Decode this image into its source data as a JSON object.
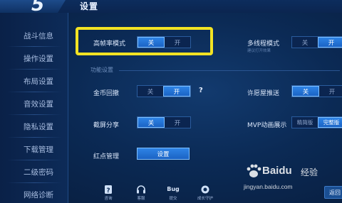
{
  "header": {
    "logo_glyph": "5",
    "title": "设置"
  },
  "sidebar": {
    "items": [
      {
        "label": "战斗信息"
      },
      {
        "label": "操作设置"
      },
      {
        "label": "布局设置"
      },
      {
        "label": "音效设置"
      },
      {
        "label": "隐私设置"
      },
      {
        "label": "下载管理"
      },
      {
        "label": "二级密码"
      },
      {
        "label": "网络诊断"
      }
    ]
  },
  "settings": {
    "high_fps": {
      "label": "高帧率模式",
      "off": "关",
      "on": "开",
      "selected": "off"
    },
    "multithread": {
      "label": "多线程模式",
      "sublabel": "建议打开效果",
      "off": "关",
      "on": "开",
      "selected": "on"
    },
    "section_title": "功能设置",
    "coin_return": {
      "label": "金币回撤",
      "off": "关",
      "on": "开",
      "selected": "on",
      "help": "?"
    },
    "permission_push": {
      "label": "许愿屋推送",
      "off": "关",
      "on": "开",
      "selected": "off"
    },
    "screenshot_share": {
      "label": "截屏分享",
      "off": "关",
      "on": "开",
      "selected": "off"
    },
    "mvp_animation": {
      "label": "MVP动画展示",
      "simple": "精简版",
      "full": "完整版",
      "selected": "full"
    },
    "red_dot": {
      "label": "红点管理",
      "button": "设置"
    }
  },
  "bottom_bar": {
    "items": [
      {
        "label": "咨询",
        "icon": "question-icon"
      },
      {
        "label": "客服",
        "icon": "headset-icon"
      },
      {
        "label": "提交",
        "icon": "bug-icon",
        "icon_text": "Bug"
      },
      {
        "label": "成长守护",
        "icon": "shield-icon"
      }
    ]
  },
  "watermark": {
    "brand": "Baidu",
    "text": "经验",
    "url": "jingyan.baidu.com"
  },
  "back_button": {
    "label": "返回"
  },
  "colors": {
    "accent": "#1b63c4",
    "highlight": "#f3e323",
    "background": "#0b2a55"
  }
}
